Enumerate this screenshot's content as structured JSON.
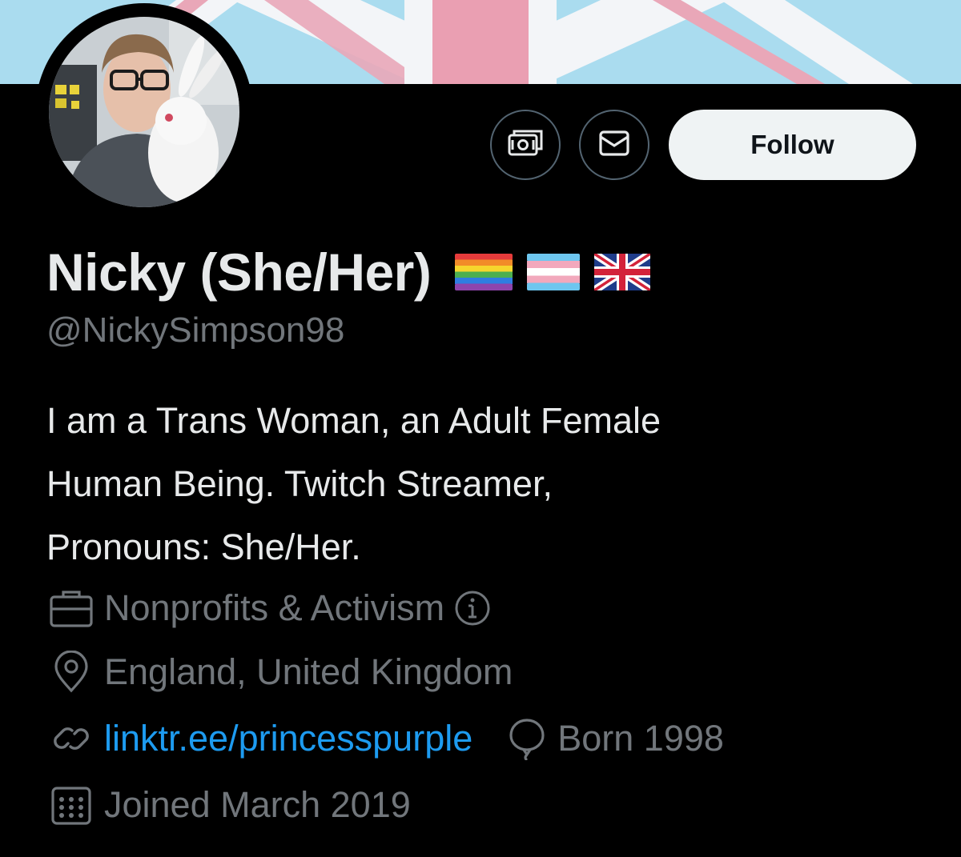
{
  "profile": {
    "display_name": "Nicky (She/Her)",
    "flags": [
      "rainbow-pride-flag",
      "transgender-flag",
      "uk-flag"
    ],
    "handle": "@NickySimpson98",
    "bio_lines": [
      "I am a Trans Woman, an Adult Female",
      "Human Being. Twitch Streamer,",
      "Pronouns: She/Her."
    ],
    "category": "Nonprofits & Activism",
    "location": "England, United Kingdom",
    "website": "linktr.ee/princesspurple",
    "birthday": "Born 1998",
    "joined": "Joined March 2019"
  },
  "actions": {
    "follow_label": "Follow",
    "tip_icon": "money-icon",
    "message_icon": "envelope-icon"
  },
  "colors": {
    "background": "#000000",
    "text_primary": "#e7e9ea",
    "text_secondary": "#71767b",
    "link": "#1d9bf0",
    "follow_bg": "#eff3f4",
    "button_border": "#536471"
  }
}
